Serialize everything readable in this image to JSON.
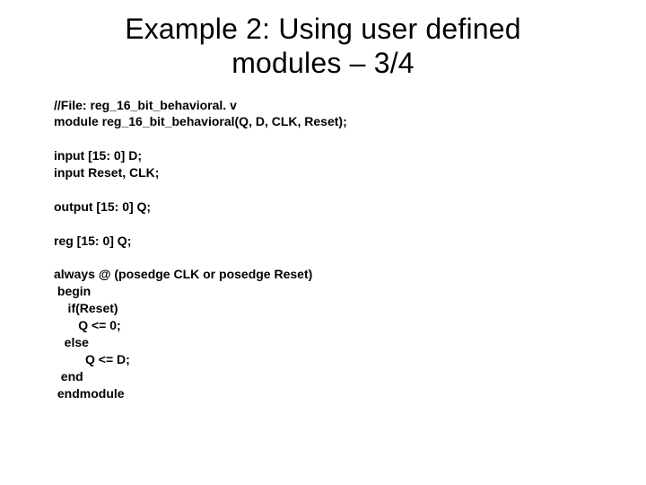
{
  "title_line1": "Example 2: Using user defined",
  "title_line2": "modules – 3/4",
  "code": "//File: reg_16_bit_behavioral. v\nmodule reg_16_bit_behavioral(Q, D, CLK, Reset);\n\ninput [15: 0] D;\ninput Reset, CLK;\n\noutput [15: 0] Q;\n\nreg [15: 0] Q;\n\nalways @ (posedge CLK or posedge Reset)\n begin\n    if(Reset)\n       Q <= 0;\n   else\n         Q <= D;\n  end\n endmodule"
}
